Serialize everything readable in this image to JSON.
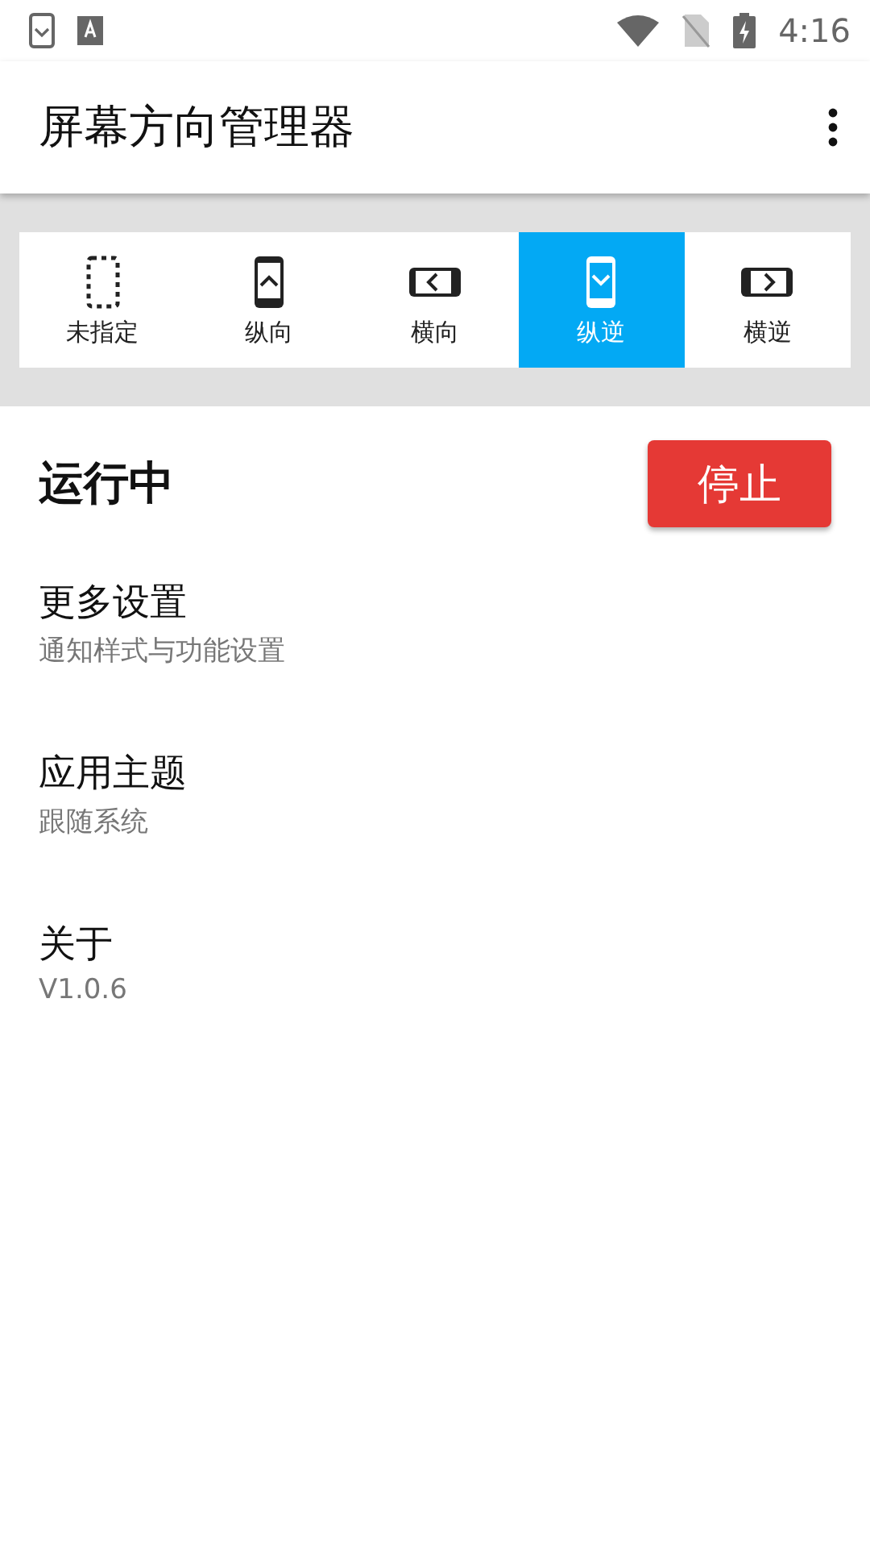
{
  "status_bar": {
    "time": "4:16"
  },
  "app_bar": {
    "title": "屏幕方向管理器"
  },
  "orientations": [
    {
      "kind": "unspecified",
      "label": "未指定",
      "selected": false
    },
    {
      "kind": "portrait",
      "label": "纵向",
      "selected": false
    },
    {
      "kind": "landscape",
      "label": "横向",
      "selected": false
    },
    {
      "kind": "reverse-portrait",
      "label": "纵逆",
      "selected": true
    },
    {
      "kind": "reverse-landscape",
      "label": "横逆",
      "selected": false
    }
  ],
  "service": {
    "status": "运行中",
    "button": "停止"
  },
  "settings": [
    {
      "title": "更多设置",
      "subtitle": "通知样式与功能设置"
    },
    {
      "title": "应用主题",
      "subtitle": "跟随系统"
    },
    {
      "title": "关于",
      "subtitle": "V1.0.6"
    }
  ]
}
